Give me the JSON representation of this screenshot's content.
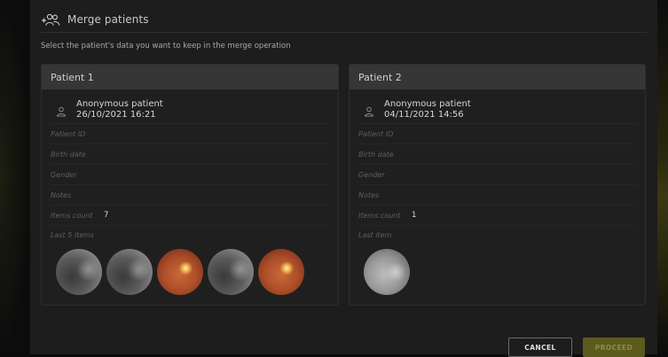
{
  "dialog": {
    "title": "Merge patients",
    "instruction": "Select the patient's data you want to keep in the merge operation",
    "icon": "merge-people-icon"
  },
  "patients": [
    {
      "header": "Patient 1",
      "name": "Anonymous patient",
      "date": "26/10/2021 16:21",
      "fields": {
        "patient_id": "Patient ID",
        "birth_date": "Birth date",
        "gender": "Gender",
        "notes": "Notes",
        "items_count_label": "Items count",
        "items_count": "7",
        "last_items_label": "Last 5 items"
      },
      "thumbnails": [
        "gray",
        "gray",
        "fundus",
        "gray",
        "fundus"
      ]
    },
    {
      "header": "Patient 2",
      "name": "Anonymous patient",
      "date": "04/11/2021 14:56",
      "fields": {
        "patient_id": "Patient ID",
        "birth_date": "Birth date",
        "gender": "Gender",
        "notes": "Notes",
        "items_count_label": "Items count",
        "items_count": "1",
        "last_items_label": "Last item"
      },
      "thumbnails": [
        "lightgray"
      ]
    }
  ],
  "buttons": {
    "cancel": "CANCEL",
    "proceed": "PROCEED"
  },
  "colors": {
    "dialog_bg": "#1d1d1d",
    "panel_header_bg": "#363636",
    "accent_disabled": "#5c5a1c"
  }
}
